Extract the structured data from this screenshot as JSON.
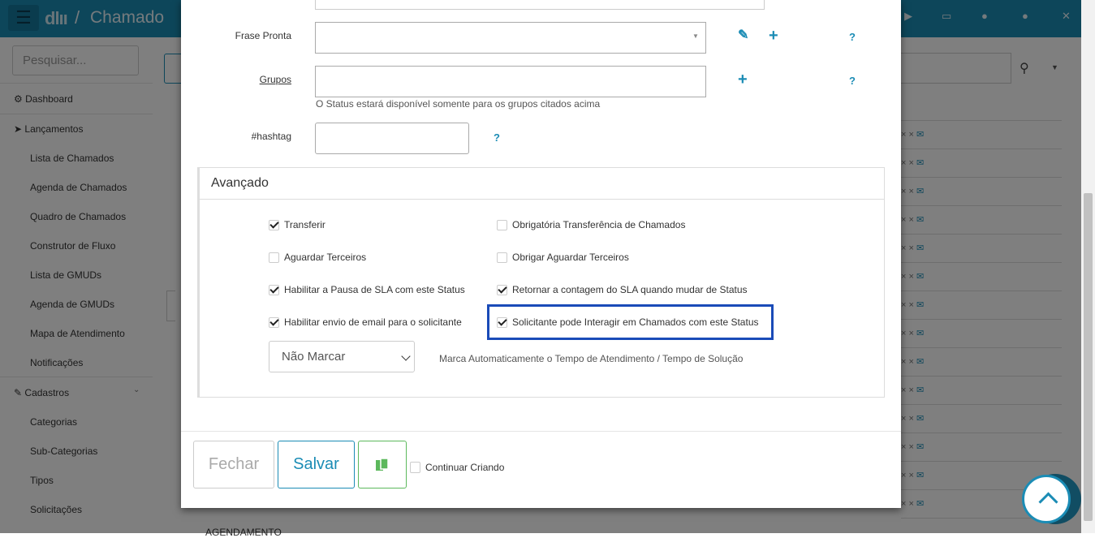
{
  "app": {
    "logo": "dlıı",
    "separator": "/",
    "title": "Chamado",
    "top_icons": [
      "play-icon",
      "monitor-icon",
      "help-circle-icon",
      "user-icon",
      "expand-icon"
    ]
  },
  "sidebar": {
    "search_placeholder": "Pesquisar...",
    "items": [
      {
        "label": "Dashboard",
        "icon": "dashboard-icon",
        "type": "section"
      },
      {
        "label": "Lançamentos",
        "icon": "send-icon",
        "type": "section"
      },
      {
        "label": "Lista de Chamados",
        "type": "sub"
      },
      {
        "label": "Agenda de Chamados",
        "type": "sub"
      },
      {
        "label": "Quadro de Chamados",
        "type": "sub"
      },
      {
        "label": "Construtor de Fluxo",
        "type": "sub"
      },
      {
        "label": "Lista de GMUDs",
        "type": "sub"
      },
      {
        "label": "Agenda de GMUDs",
        "type": "sub"
      },
      {
        "label": "Mapa de Atendimento",
        "type": "sub"
      },
      {
        "label": "Notificações",
        "type": "sub"
      },
      {
        "label": "Cadastros",
        "icon": "edit-icon",
        "type": "section"
      },
      {
        "label": "Categorias",
        "type": "sub"
      },
      {
        "label": "Sub-Categorias",
        "type": "sub"
      },
      {
        "label": "Tipos",
        "type": "sub"
      },
      {
        "label": "Solicitações",
        "type": "sub"
      }
    ]
  },
  "background": {
    "last_row_text": "AGENDAMENTO"
  },
  "modal": {
    "form": {
      "frase_pronta_label": "Frase Pronta",
      "frase_pronta_value": "",
      "grupos_label": "Grupos",
      "grupos_value": "",
      "grupos_help": "O Status estará disponível somente para os grupos citados acima",
      "hashtag_label": "#hashtag",
      "hashtag_value": "",
      "help_symbol": "?"
    },
    "advanced": {
      "title": "Avançado",
      "checkboxes": [
        {
          "label": "Transferir",
          "checked": true
        },
        {
          "label": "Obrigatória Transferência de Chamados",
          "checked": false
        },
        {
          "label": "Aguardar Terceiros",
          "checked": false
        },
        {
          "label": "Obrigar Aguardar Terceiros",
          "checked": false
        },
        {
          "label": "Habilitar a Pausa de SLA com este Status",
          "checked": true
        },
        {
          "label": "Retornar a contagem do SLA quando mudar de Status",
          "checked": true
        },
        {
          "label": "Habilitar envio de email para o solicitante",
          "checked": true
        },
        {
          "label": "Solicitante pode Interagir em Chamados com este Status",
          "checked": true
        }
      ],
      "mark_select_value": "Não Marcar",
      "mark_caption": "Marca Automaticamente o Tempo de Atendimento / Tempo de Solução"
    },
    "footer": {
      "close_label": "Fechar",
      "save_label": "Salvar",
      "continue_label": "Continuar Criando",
      "continue_checked": false
    }
  },
  "colors": {
    "primary": "#1b8cb5",
    "highlight": "#1a4bb8",
    "success": "#5cb85c"
  }
}
